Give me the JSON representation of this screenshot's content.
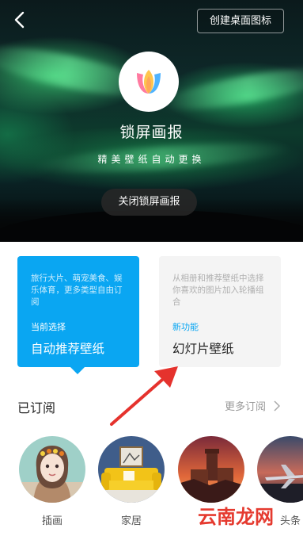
{
  "header": {
    "create_shortcut_label": "创建桌面图标",
    "app_name": "锁屏画报",
    "tagline": "精美壁纸自动更换",
    "close_label": "关闭锁屏画报"
  },
  "options": [
    {
      "description": "旅行大片、萌宠美食、娱乐体育，更多类型自由订阅",
      "tag": "当前选择",
      "name": "自动推荐壁纸",
      "selected": true
    },
    {
      "description": "从相册和推荐壁纸中选择你喜欢的图片加入轮播组合",
      "tag": "新功能",
      "name": "幻灯片壁纸",
      "selected": false
    }
  ],
  "subscribed": {
    "title": "已订阅",
    "more_label": "更多订阅",
    "items": [
      {
        "label": "插画",
        "icon": "illustration-girl"
      },
      {
        "label": "家居",
        "icon": "yellow-sofa"
      },
      {
        "label": "",
        "icon": "castle-sunset"
      },
      {
        "label": "头条",
        "icon": "airplane"
      }
    ]
  },
  "watermark": "云南龙网",
  "colors": {
    "accent": "#0aa6f2",
    "arrow": "#e5322d",
    "watermark": "#e53a2f"
  }
}
